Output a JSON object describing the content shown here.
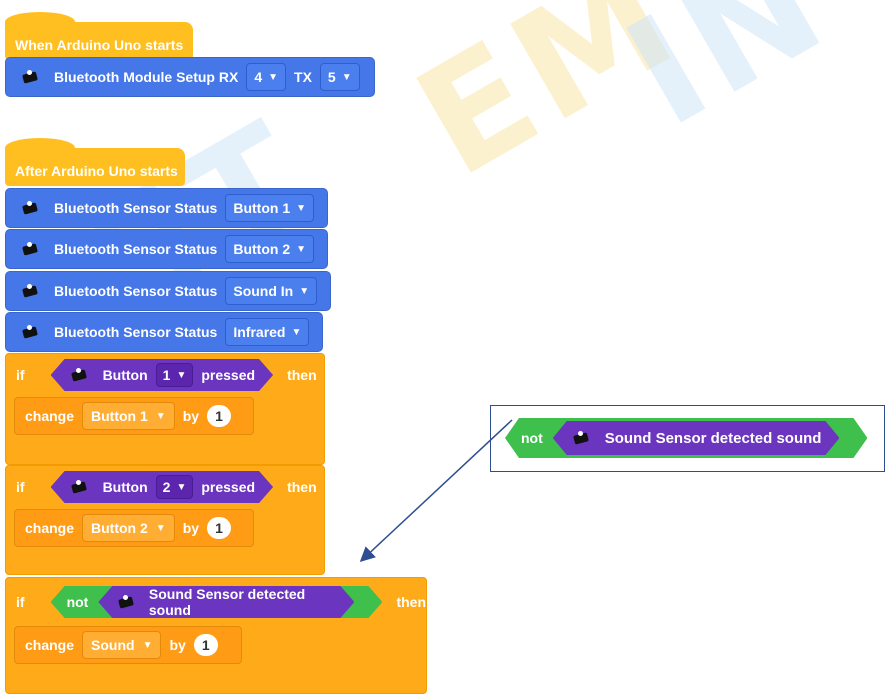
{
  "hat1": {
    "label": "When Arduino Uno starts"
  },
  "setup": {
    "label": "Bluetooth Module Setup RX",
    "rx": "4",
    "tx_label": "TX",
    "tx": "5"
  },
  "hat2": {
    "label": "After Arduino Uno starts"
  },
  "status_blocks": [
    {
      "label": "Bluetooth Sensor Status",
      "option": "Button 1"
    },
    {
      "label": "Bluetooth Sensor Status",
      "option": "Button 2"
    },
    {
      "label": "Bluetooth Sensor Status",
      "option": "Sound In"
    },
    {
      "label": "Bluetooth Sensor Status",
      "option": "Infrared"
    }
  ],
  "if_blocks": [
    {
      "kw": "if",
      "cond_label": "Button",
      "cond_option": "1",
      "cond_suffix": "pressed",
      "then": "then",
      "change": {
        "label": "change",
        "var": "Button 1",
        "by": "by",
        "value": "1"
      }
    },
    {
      "kw": "if",
      "cond_label": "Button",
      "cond_option": "2",
      "cond_suffix": "pressed",
      "then": "then",
      "change": {
        "label": "change",
        "var": "Button 2",
        "by": "by",
        "value": "1"
      }
    },
    {
      "kw": "if",
      "not": "not",
      "cond_label": "Sound Sensor detected sound",
      "then": "then",
      "change": {
        "label": "change",
        "var": "Sound",
        "by": "by",
        "value": "1"
      }
    }
  ],
  "callout": {
    "not": "not",
    "label": "Sound Sensor detected sound"
  },
  "dropdown_arrow": "▼",
  "colors": {
    "motion_blue": "#4577e8",
    "event_yellow": "#ffbf21",
    "control_orange": "#ffab19",
    "sensor_purple": "#6b35bf",
    "operator_green": "#3fbf4c"
  }
}
